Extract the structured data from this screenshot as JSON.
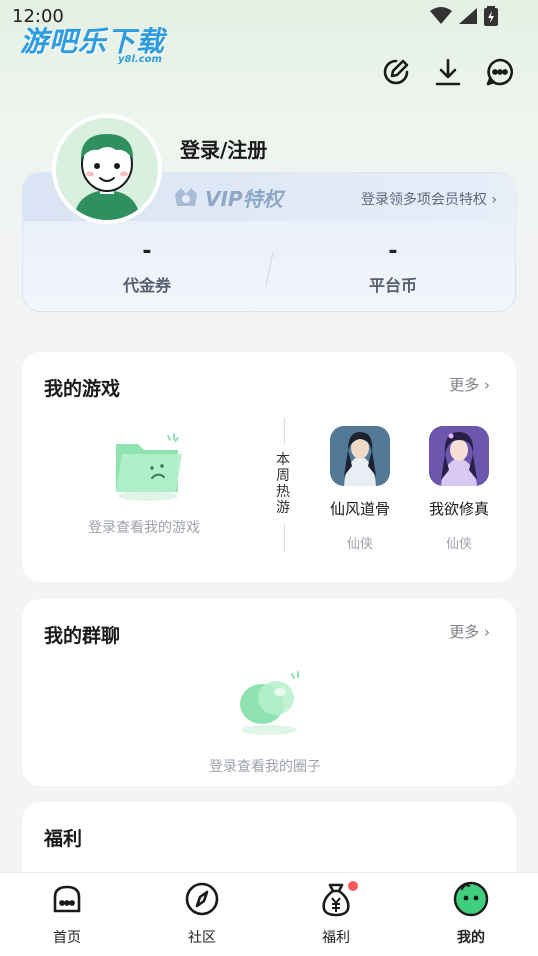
{
  "status_bar": {
    "time": "12:00"
  },
  "logo": {
    "main": "游吧乐下载",
    "sub": "y8l.com"
  },
  "top_actions": [
    {
      "icon": "edit-icon"
    },
    {
      "icon": "download-icon"
    },
    {
      "icon": "message-icon"
    }
  ],
  "profile": {
    "login_label": "登录/注册",
    "vip_label": "VIP特权",
    "vip_link": "登录领多项会员特权 ›",
    "stats": [
      {
        "value": "-",
        "label": "代金券"
      },
      {
        "value": "-",
        "label": "平台币"
      }
    ]
  },
  "my_games": {
    "title": "我的游戏",
    "more": "更多 ›",
    "empty_text": "登录查看我的游戏",
    "weekly_label": "本周热游",
    "games": [
      {
        "name": "仙风道骨",
        "tag": "仙侠"
      },
      {
        "name": "我欲修真",
        "tag": "仙侠"
      }
    ]
  },
  "my_groups": {
    "title": "我的群聊",
    "more": "更多 ›",
    "empty_text": "登录查看我的圈子"
  },
  "welfare": {
    "title": "福利"
  },
  "bottom_nav": {
    "items": [
      {
        "label": "首页",
        "icon": "home-icon"
      },
      {
        "label": "社区",
        "icon": "compass-icon"
      },
      {
        "label": "福利",
        "icon": "money-bag-icon"
      },
      {
        "label": "我的",
        "icon": "profile-icon"
      }
    ],
    "active_index": 3
  },
  "colors": {
    "accent_blue": "#2c9be0",
    "green": "#3fcf7c",
    "badge_red": "#ff5a5a"
  }
}
